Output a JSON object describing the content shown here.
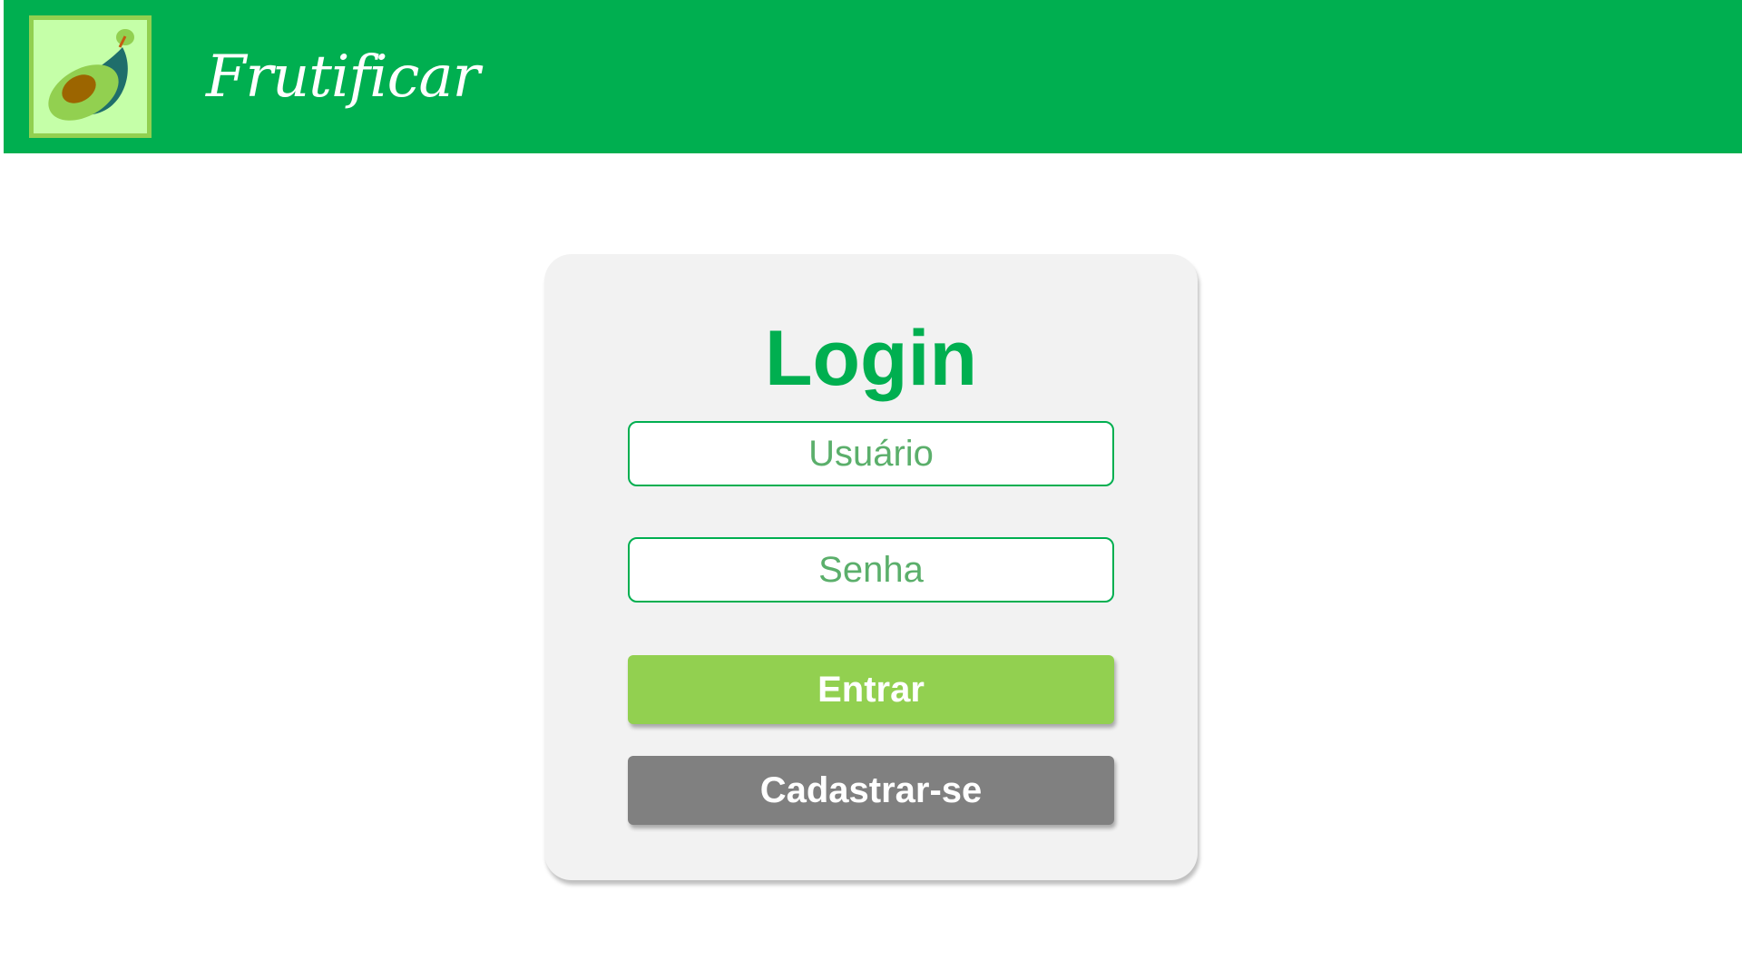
{
  "header": {
    "brand": "Frutificar",
    "logo_icon": "avocado-icon",
    "background_color": "#00AF50"
  },
  "login": {
    "title": "Login",
    "username_placeholder": "Usuário",
    "password_placeholder": "Senha",
    "submit_label": "Entrar",
    "register_label": "Cadastrar-se"
  },
  "colors": {
    "accent": "#00AF50",
    "login_button": "#92D050",
    "register_button": "#808080",
    "card": "#F2F2F2"
  }
}
